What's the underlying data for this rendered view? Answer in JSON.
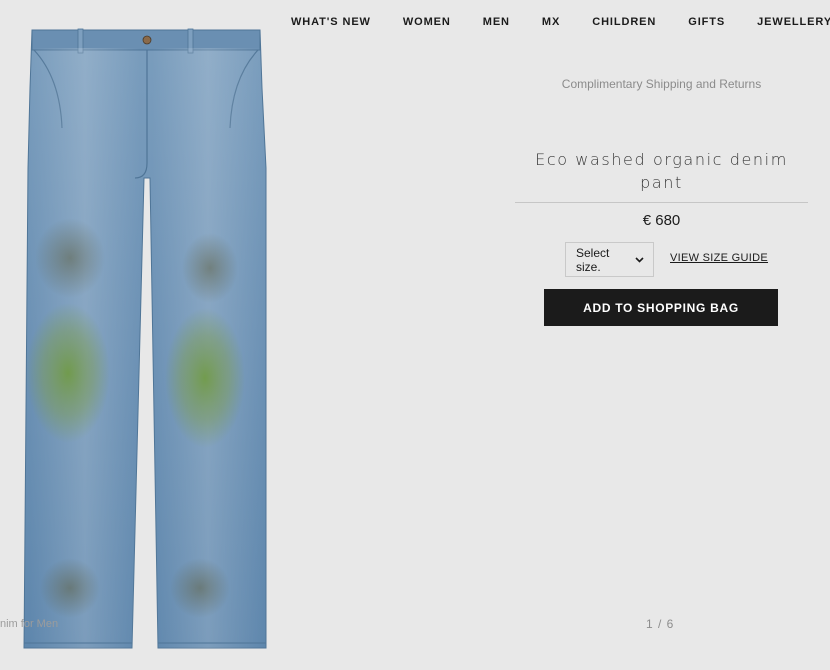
{
  "nav": {
    "items": [
      {
        "label": "WHAT'S NEW"
      },
      {
        "label": "WOMEN"
      },
      {
        "label": "MEN"
      },
      {
        "label": "MX"
      },
      {
        "label": "CHILDREN"
      },
      {
        "label": "GIFTS"
      },
      {
        "label": "JEWELLERY & WATCHES"
      }
    ]
  },
  "gallery": {
    "caption": "nim for Men",
    "pager": "1 / 6"
  },
  "product": {
    "shipping_note": "Complimentary Shipping and Returns",
    "title": "Eco washed organic denim pant",
    "price": "€ 680",
    "size_select_label": "Select size.",
    "size_guide_label": "VIEW SIZE GUIDE",
    "add_to_bag_label": "ADD TO SHOPPING BAG"
  },
  "colors": {
    "background": "#e8e8e8",
    "button": "#1b1b1b",
    "denim": "#6e93b6"
  }
}
